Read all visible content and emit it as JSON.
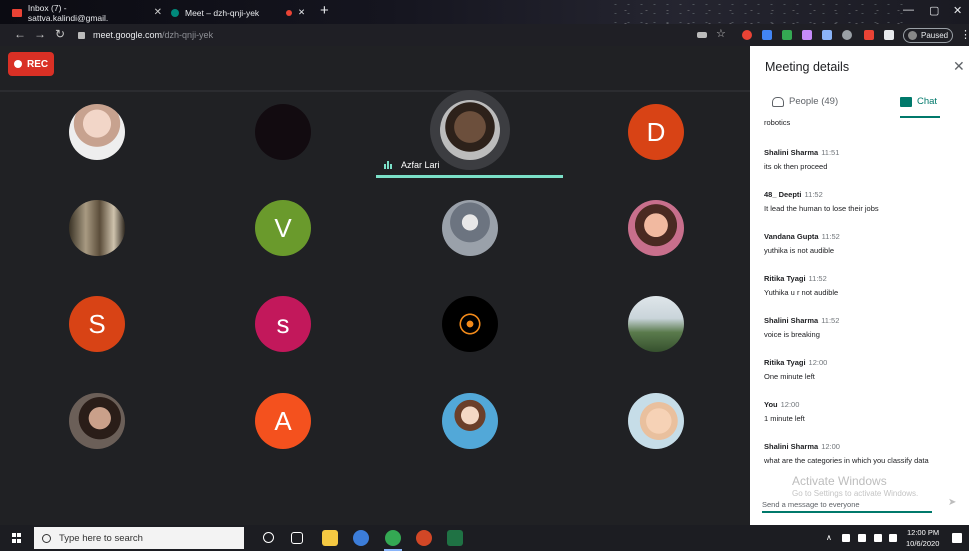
{
  "browser": {
    "tabs": [
      {
        "title": "Inbox (7) - sattva.kalindi@gmail.",
        "favicon": "gmail-icon",
        "color": "#ea4335"
      },
      {
        "title": "Meet – dzh-qnji-yek",
        "favicon": "meet-icon",
        "color": "#00897b"
      }
    ],
    "url_host": "meet.google.com",
    "url_path": "/dzh-qnji-yek",
    "profile_label": "Paused"
  },
  "meet": {
    "rec_label": "REC",
    "speaker_name": "Azfar Lari",
    "accent_color": "#7be0c8",
    "participants": [
      {
        "kind": "photo",
        "icon": "avatar-photo"
      },
      {
        "kind": "photo",
        "icon": "avatar-photo"
      },
      {
        "kind": "letter",
        "letter": "D",
        "color": "#d84315"
      },
      {
        "kind": "photo",
        "icon": "avatar-photo"
      },
      {
        "kind": "letter",
        "letter": "V",
        "color": "#6a9a2c"
      },
      {
        "kind": "photo",
        "icon": "avatar-photo"
      },
      {
        "kind": "photo",
        "icon": "avatar-photo"
      },
      {
        "kind": "letter",
        "letter": "S",
        "color": "#d84315"
      },
      {
        "kind": "letter",
        "letter": "s",
        "color": "#c2185b"
      },
      {
        "kind": "photo",
        "icon": "avatar-photo"
      },
      {
        "kind": "photo",
        "icon": "avatar-photo"
      },
      {
        "kind": "photo",
        "icon": "avatar-photo"
      },
      {
        "kind": "letter",
        "letter": "A",
        "color": "#f4511e"
      },
      {
        "kind": "photo",
        "icon": "avatar-photo"
      },
      {
        "kind": "photo",
        "icon": "avatar-photo"
      }
    ]
  },
  "panel": {
    "title": "Meeting details",
    "tab_people": "People (49)",
    "tab_chat": "Chat",
    "fragment": "robotics",
    "messages": [
      {
        "sender": "Shalini Sharma",
        "time": "11:51",
        "text": "its ok then proceed"
      },
      {
        "sender": "48_ Deepti",
        "time": "11:52",
        "text": "It lead the human to lose their jobs"
      },
      {
        "sender": "Vandana Gupta",
        "time": "11:52",
        "text": "yuthika is not audible"
      },
      {
        "sender": "Ritika Tyagi",
        "time": "11:52",
        "text": "Yuthika u r not audible"
      },
      {
        "sender": "Shalini Sharma",
        "time": "11:52",
        "text": "voice is breaking"
      },
      {
        "sender": "Ritika Tyagi",
        "time": "12:00",
        "text": "One minute left"
      },
      {
        "sender": "You",
        "time": "12:00",
        "text": "1 minute left"
      },
      {
        "sender": "Shalini Sharma",
        "time": "12:00",
        "text": "what are the categories in which you classify data"
      }
    ],
    "input_placeholder": "Send a message to everyone",
    "watermark_title": "Activate Windows",
    "watermark_sub": "Go to Settings to activate Windows."
  },
  "taskbar": {
    "search_placeholder": "Type here to search",
    "time": "12:00 PM",
    "date": "10/6/2020"
  }
}
